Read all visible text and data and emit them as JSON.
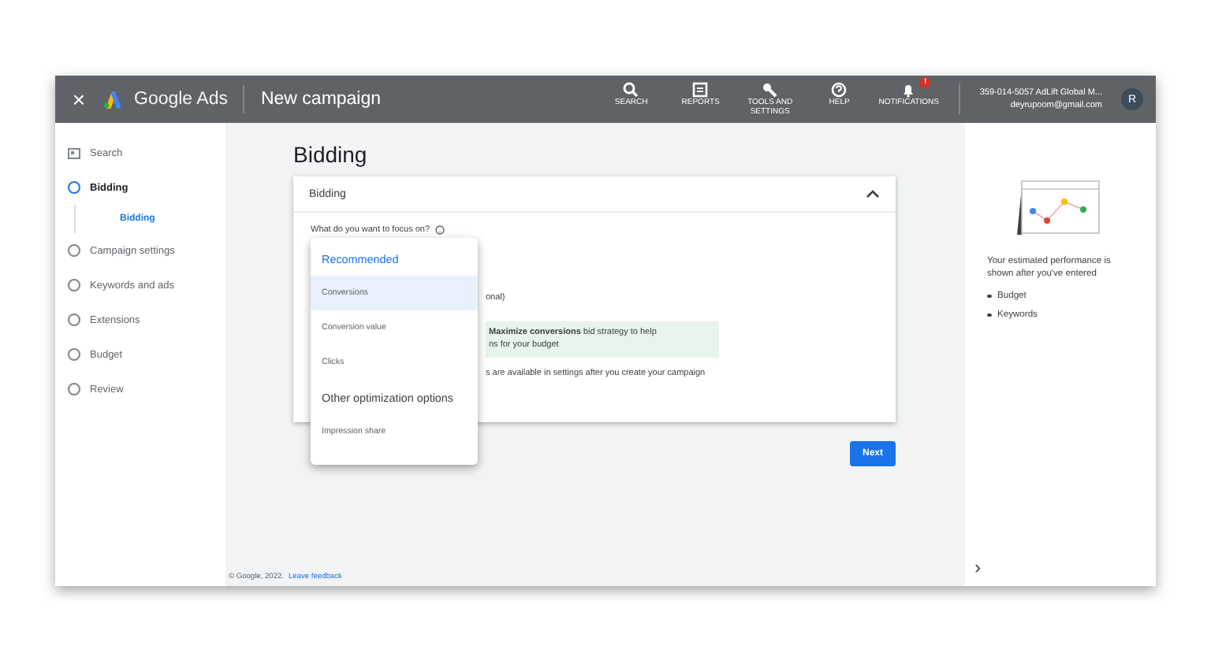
{
  "topbar": {
    "close": "×",
    "product": "Google Ads",
    "title": "New campaign",
    "tools": [
      {
        "label": "SEARCH",
        "kind": "search"
      },
      {
        "label": "REPORTS",
        "kind": "reports"
      },
      {
        "label": "TOOLS AND SETTINGS",
        "kind": "tools"
      },
      {
        "label": "HELP",
        "kind": "help"
      },
      {
        "label": "NOTIFICATIONS",
        "kind": "bell",
        "badge": "!"
      }
    ],
    "account": {
      "name": "359-014-5057 AdLift Global M...",
      "email": "deyrupoom@gmail.com",
      "avatar": "R"
    }
  },
  "sidebar": {
    "items": [
      {
        "label": "Search",
        "kind": "type",
        "selected": false
      },
      {
        "label": "Bidding",
        "kind": "step",
        "selected": true,
        "children": [
          {
            "label": "Bidding",
            "selected": true
          }
        ]
      },
      {
        "label": "Campaign settings",
        "kind": "step",
        "selected": false
      },
      {
        "label": "Keywords and ads",
        "kind": "step",
        "selected": false
      },
      {
        "label": "Extensions",
        "kind": "step",
        "selected": false
      },
      {
        "label": "Budget",
        "kind": "step",
        "selected": false
      },
      {
        "label": "Review",
        "kind": "step",
        "selected": false
      }
    ]
  },
  "main": {
    "heading": "Bidding",
    "card": {
      "title": "Bidding",
      "expanded": true,
      "question": "What do you want to focus on?",
      "partial_label": "onal)",
      "tip_line_1": "**Maximize conversions** bid strategy to help",
      "tip_line_2": "ns for your budget",
      "note": "s are available in settings after you create your campaign"
    },
    "dropdown": [
      {
        "kind": "group",
        "label": "Recommended",
        "highlighted": true
      },
      {
        "kind": "option",
        "label": "Conversions",
        "selected": true
      },
      {
        "kind": "option",
        "label": "Conversion value",
        "selected": false
      },
      {
        "kind": "option",
        "label": "Clicks",
        "selected": false
      },
      {
        "kind": "group",
        "label": "Other optimization options",
        "highlighted": false
      },
      {
        "kind": "option",
        "label": "Impression share",
        "selected": false
      }
    ],
    "next_button": "Next",
    "footer": {
      "copyright": "© Google, 2022.",
      "link": "Leave feedback"
    }
  },
  "right_panel": {
    "text": "Your estimated performance is shown after you've entered",
    "bullets": [
      "Budget",
      "Keywords"
    ],
    "expand": "›"
  }
}
